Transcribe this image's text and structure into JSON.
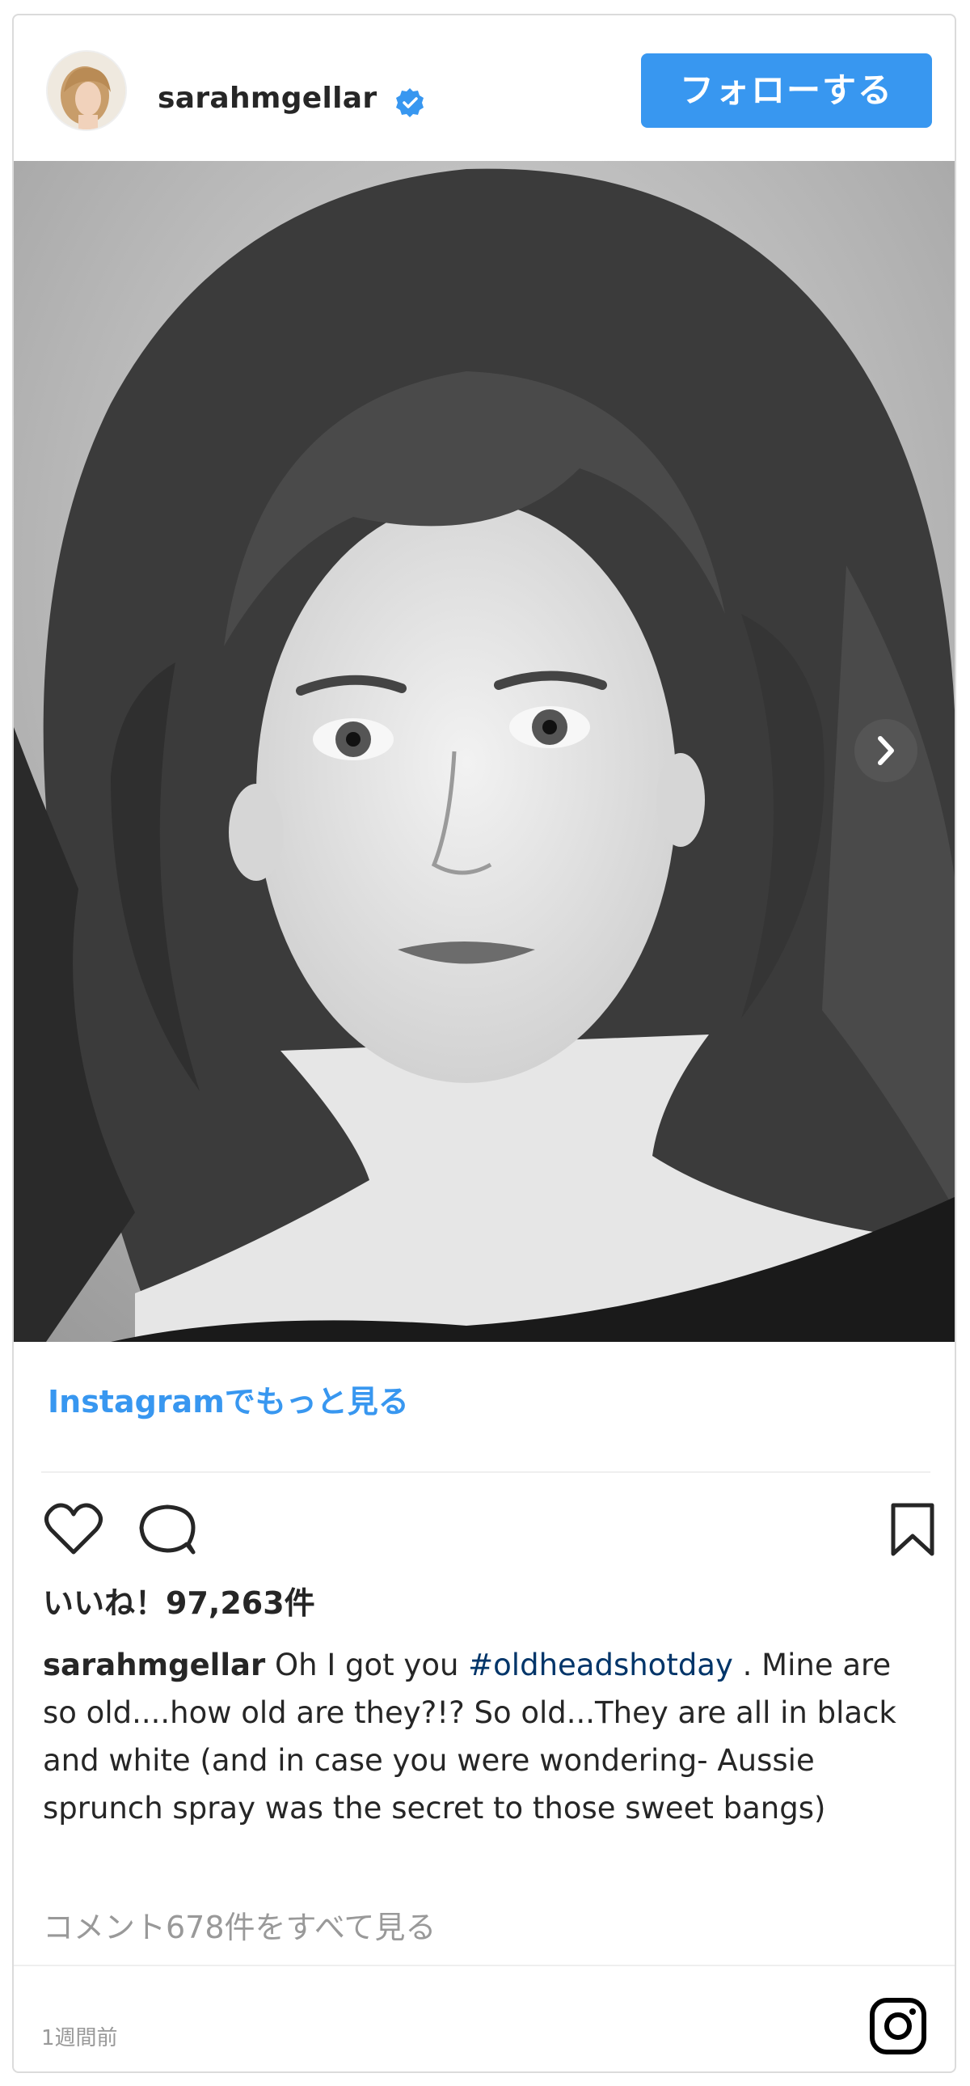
{
  "header": {
    "username": "sarahmgellar",
    "verified_icon": "verified-badge-icon",
    "follow_label": "フォローする"
  },
  "colors": {
    "accent": "#3897f0",
    "hashtag": "#003569",
    "muted": "#999999",
    "border": "#dbdbdb"
  },
  "media": {
    "description_icon": "photo",
    "next_icon": "chevron-right-icon"
  },
  "more_link": "Instagramでもっと見る",
  "actions": {
    "like_icon": "heart-icon",
    "comment_icon": "comment-icon",
    "save_icon": "bookmark-icon"
  },
  "likes_text": "いいね！97,263件",
  "caption": {
    "username": "sarahmgellar",
    "text_before": " Oh I got you ",
    "hashtag": "#oldheadshotday",
    "text_after": " . Mine are so old....how old are they?!? So old...They are all in black and white (and in case you were wondering- Aussie sprunch spray was the secret to those sweet bangs)"
  },
  "comments_link": "コメント678件をすべて見る",
  "footer": {
    "timestamp": "1週間前",
    "logo_icon": "instagram-logo-icon"
  }
}
